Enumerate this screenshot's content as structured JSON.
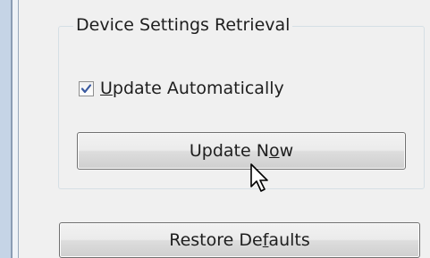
{
  "group": {
    "title": "Device Settings Retrieval"
  },
  "checkbox": {
    "label_accel": "U",
    "label_rest": "pdate Automatically",
    "checked": true
  },
  "update_button": {
    "label_pre": "Update N",
    "label_accel": "o",
    "label_post": "w"
  },
  "restore_button": {
    "label_pre": "Restore De",
    "label_accel": "f",
    "label_post": "aults"
  },
  "colors": {
    "panel_bg": "#f0f0f0",
    "check_mark": "#3a5aa0"
  },
  "icons": {
    "cursor": "arrow-cursor-icon",
    "check": "checkmark-icon"
  }
}
